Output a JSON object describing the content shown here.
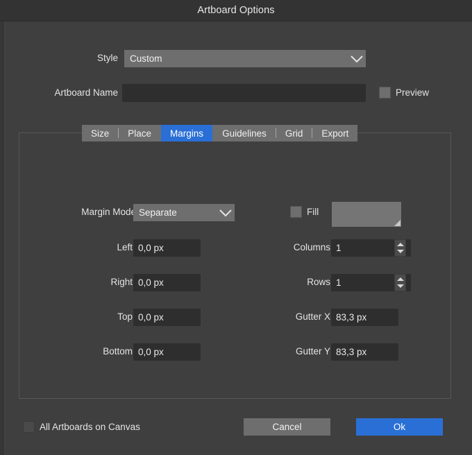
{
  "window": {
    "title": "Artboard Options"
  },
  "top_form": {
    "style": {
      "label": "Style",
      "value": "Custom"
    },
    "artboard_name": {
      "label": "Artboard Name",
      "value": "",
      "placeholder": ""
    },
    "preview": {
      "label": "Preview",
      "checked": false
    }
  },
  "tabs": [
    {
      "label": "Size",
      "selected": false
    },
    {
      "label": "Place",
      "selected": false
    },
    {
      "label": "Margins",
      "selected": true
    },
    {
      "label": "Guidelines",
      "selected": false
    },
    {
      "label": "Grid",
      "selected": false
    },
    {
      "label": "Export",
      "selected": false
    }
  ],
  "margins_panel": {
    "margin_mode": {
      "label": "Margin Mode",
      "value": "Separate"
    },
    "left": {
      "label": "Left",
      "value": "0,0 px"
    },
    "right": {
      "label": "Right",
      "value": "0,0 px"
    },
    "top": {
      "label": "Top",
      "value": "0,0 px"
    },
    "bottom": {
      "label": "Bottom",
      "value": "0,0 px"
    },
    "fill": {
      "label": "Fill",
      "checked": false,
      "swatch_color": "#757575"
    },
    "columns": {
      "label": "Columns",
      "value": "1"
    },
    "rows": {
      "label": "Rows",
      "value": "1"
    },
    "gutter_x": {
      "label": "Gutter X",
      "value": "83,3 px"
    },
    "gutter_y": {
      "label": "Gutter Y",
      "value": "83,3 px"
    }
  },
  "footer": {
    "all_artboards": {
      "label": "All Artboards on Canvas",
      "checked": false
    },
    "cancel_label": "Cancel",
    "ok_label": "Ok"
  },
  "colors": {
    "accent_blue": "#2a6fd6",
    "dialog_bg": "#3f3f3f",
    "titlebar_bg": "#333333",
    "control_grey": "#6e6e6e",
    "input_dark": "#2e2e2e"
  }
}
